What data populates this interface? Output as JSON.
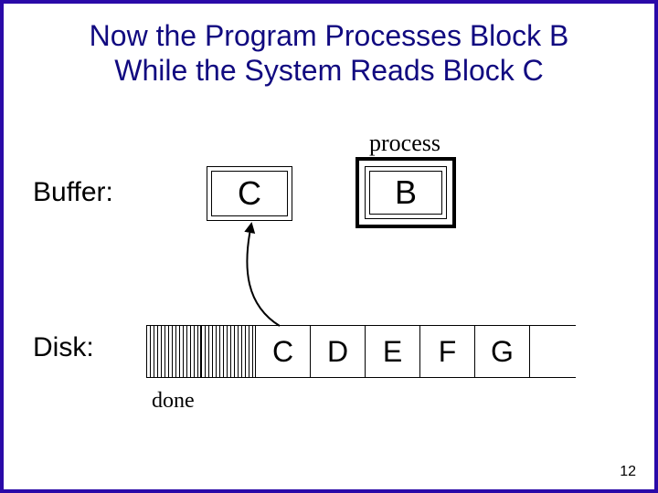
{
  "title_line1": "Now the Program Processes Block B",
  "title_line2": "While the System Reads Block C",
  "labels": {
    "buffer": "Buffer:",
    "disk": "Disk:",
    "process": "process",
    "done": "done"
  },
  "buffer": {
    "left": "C",
    "right": "B"
  },
  "disk_cells": [
    "",
    "",
    "C",
    "D",
    "E",
    "F",
    "G"
  ],
  "page_number": "12"
}
